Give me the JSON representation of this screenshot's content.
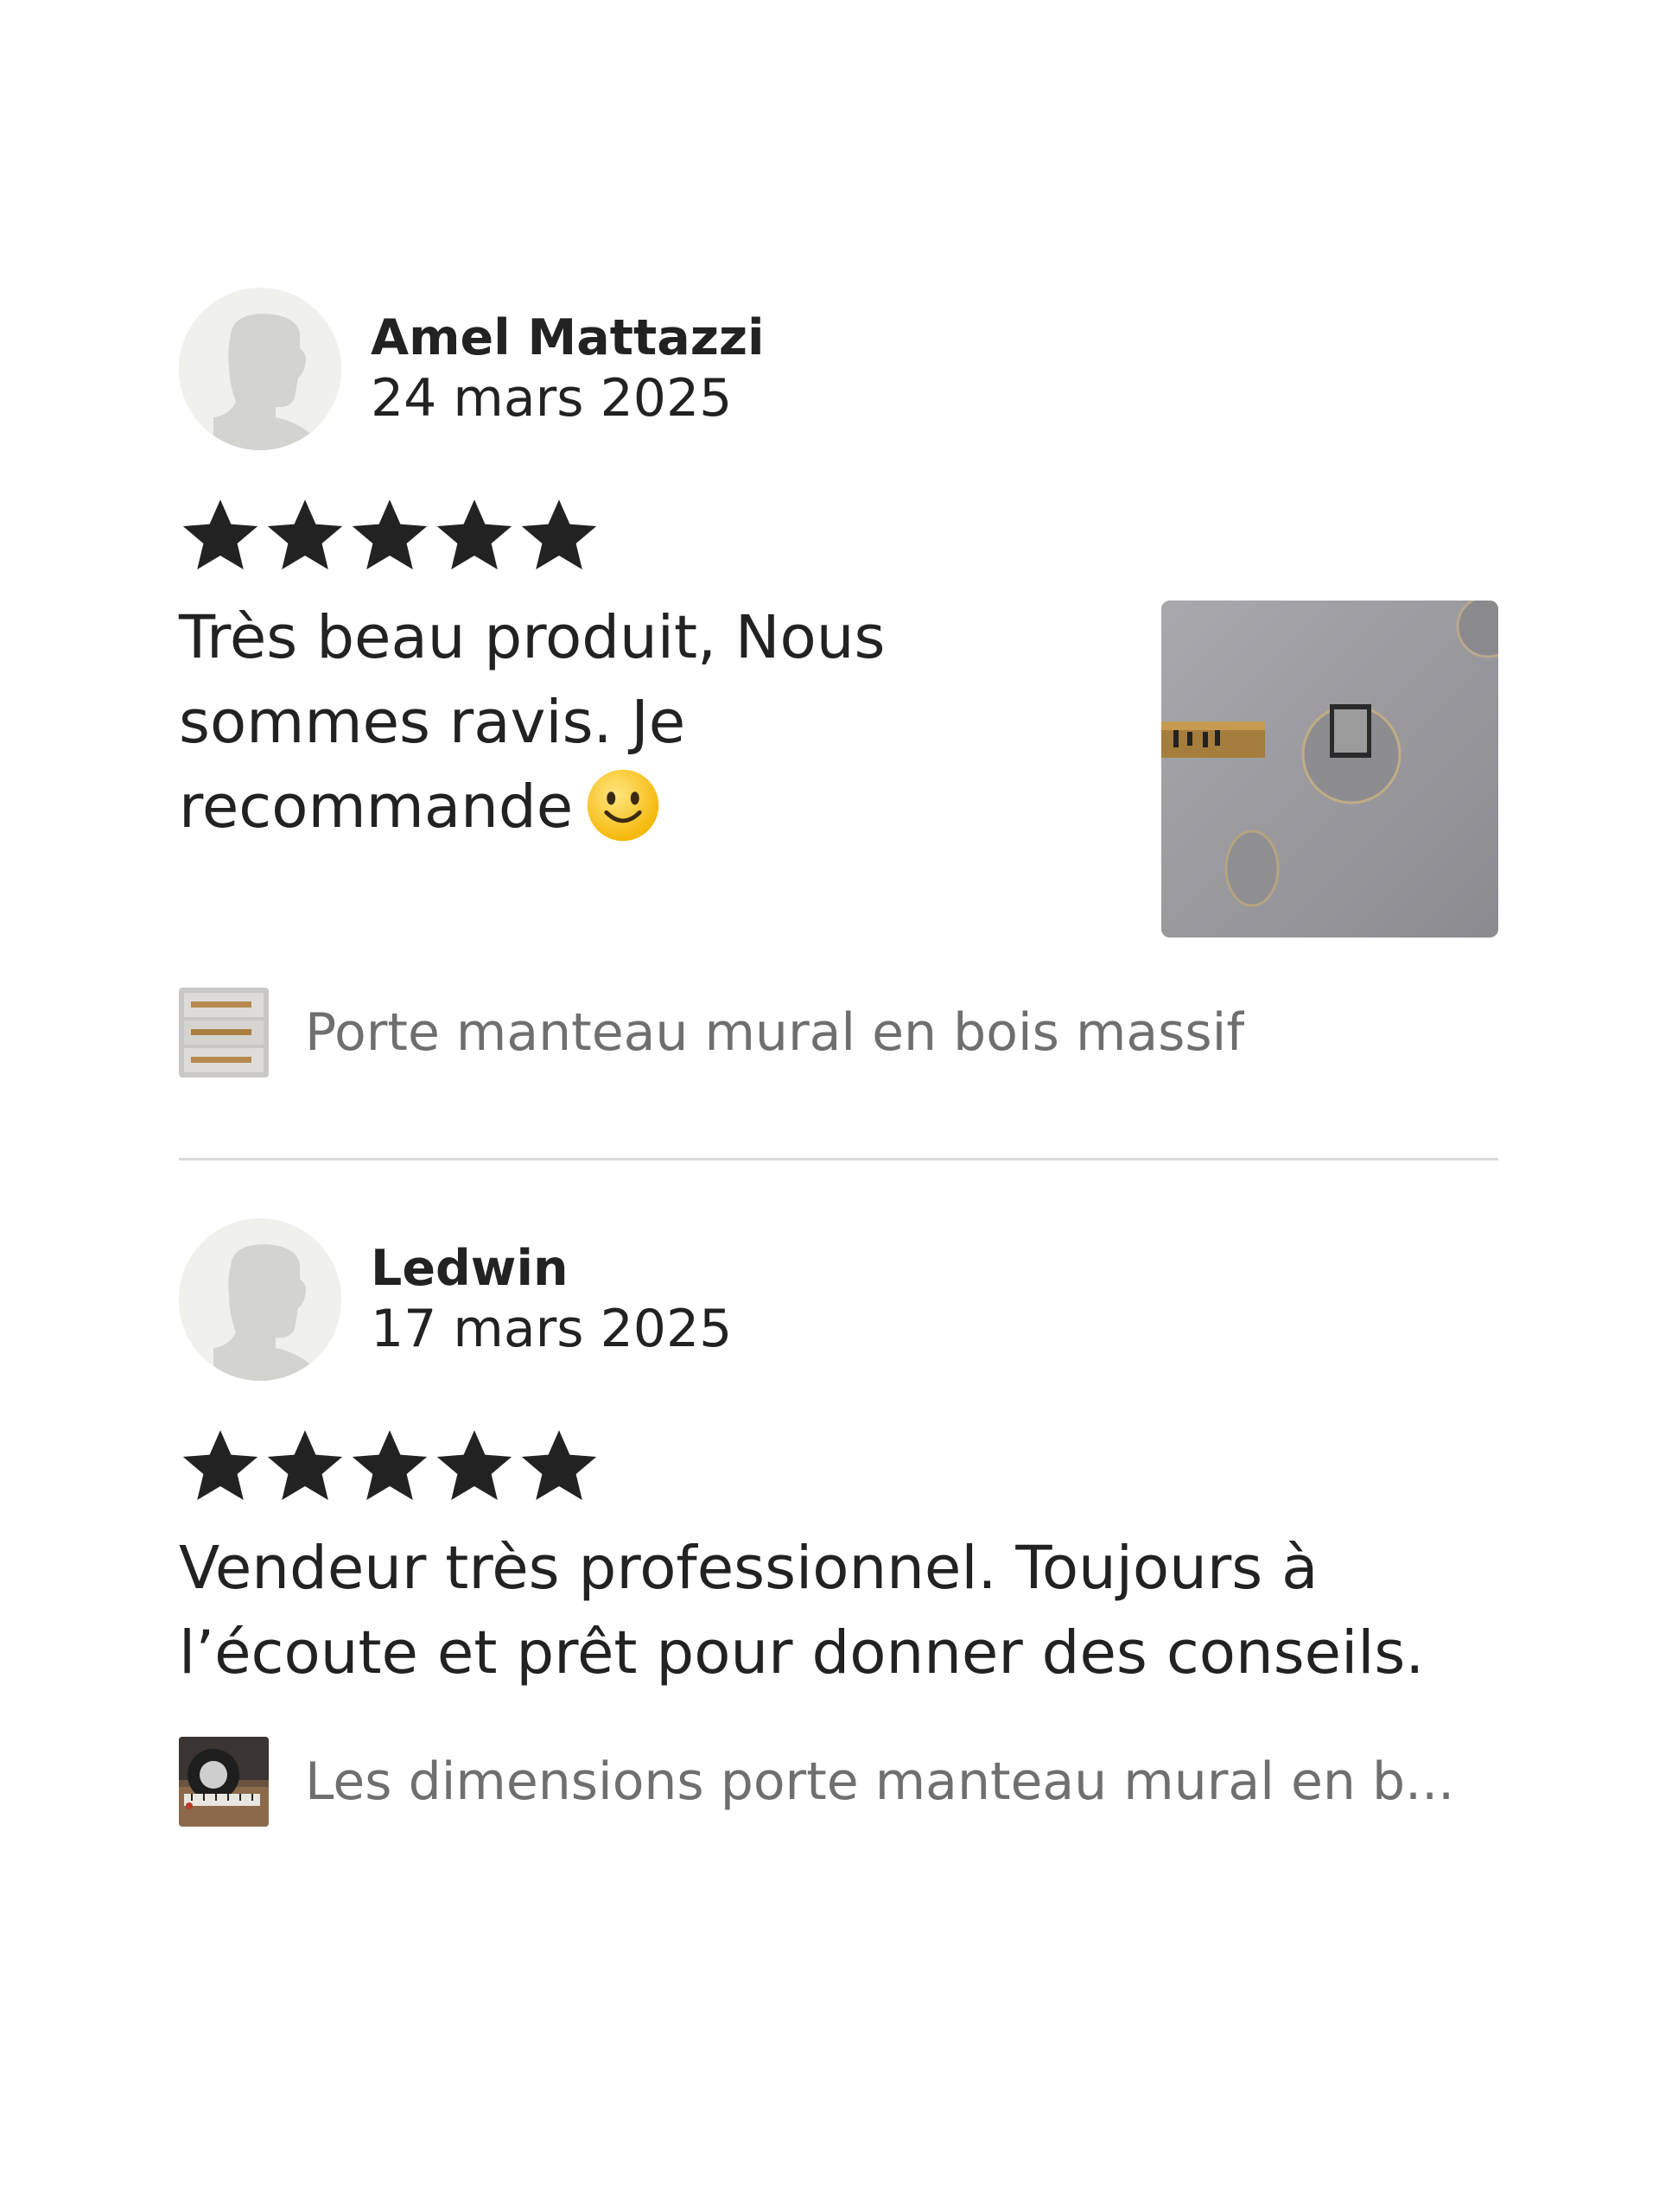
{
  "reviews": [
    {
      "reviewer": "Amel Mattazzi",
      "date": "24 mars 2025",
      "rating": 5,
      "text": "Très beau produit, Nous sommes ravis. Je recommande",
      "emoji_icon": "slightly-smiling-face",
      "has_photo": true,
      "product": "Porte manteau mural en bois massif"
    },
    {
      "reviewer": "Ledwin",
      "date": "17 mars 2025",
      "rating": 5,
      "text": "Vendeur très professionnel. Toujours à l’écoute et prêt pour donner des conseils.",
      "has_photo": false,
      "product": "Les dimensions porte manteau mural en b..."
    }
  ],
  "colors": {
    "star": "#222222",
    "text": "#222222",
    "muted": "#6f6f6f",
    "divider": "#d9d9d9",
    "avatar_bg": "#f0f0ec"
  },
  "icons": {
    "avatar": "default-user-silhouette",
    "star": "filled-star"
  }
}
